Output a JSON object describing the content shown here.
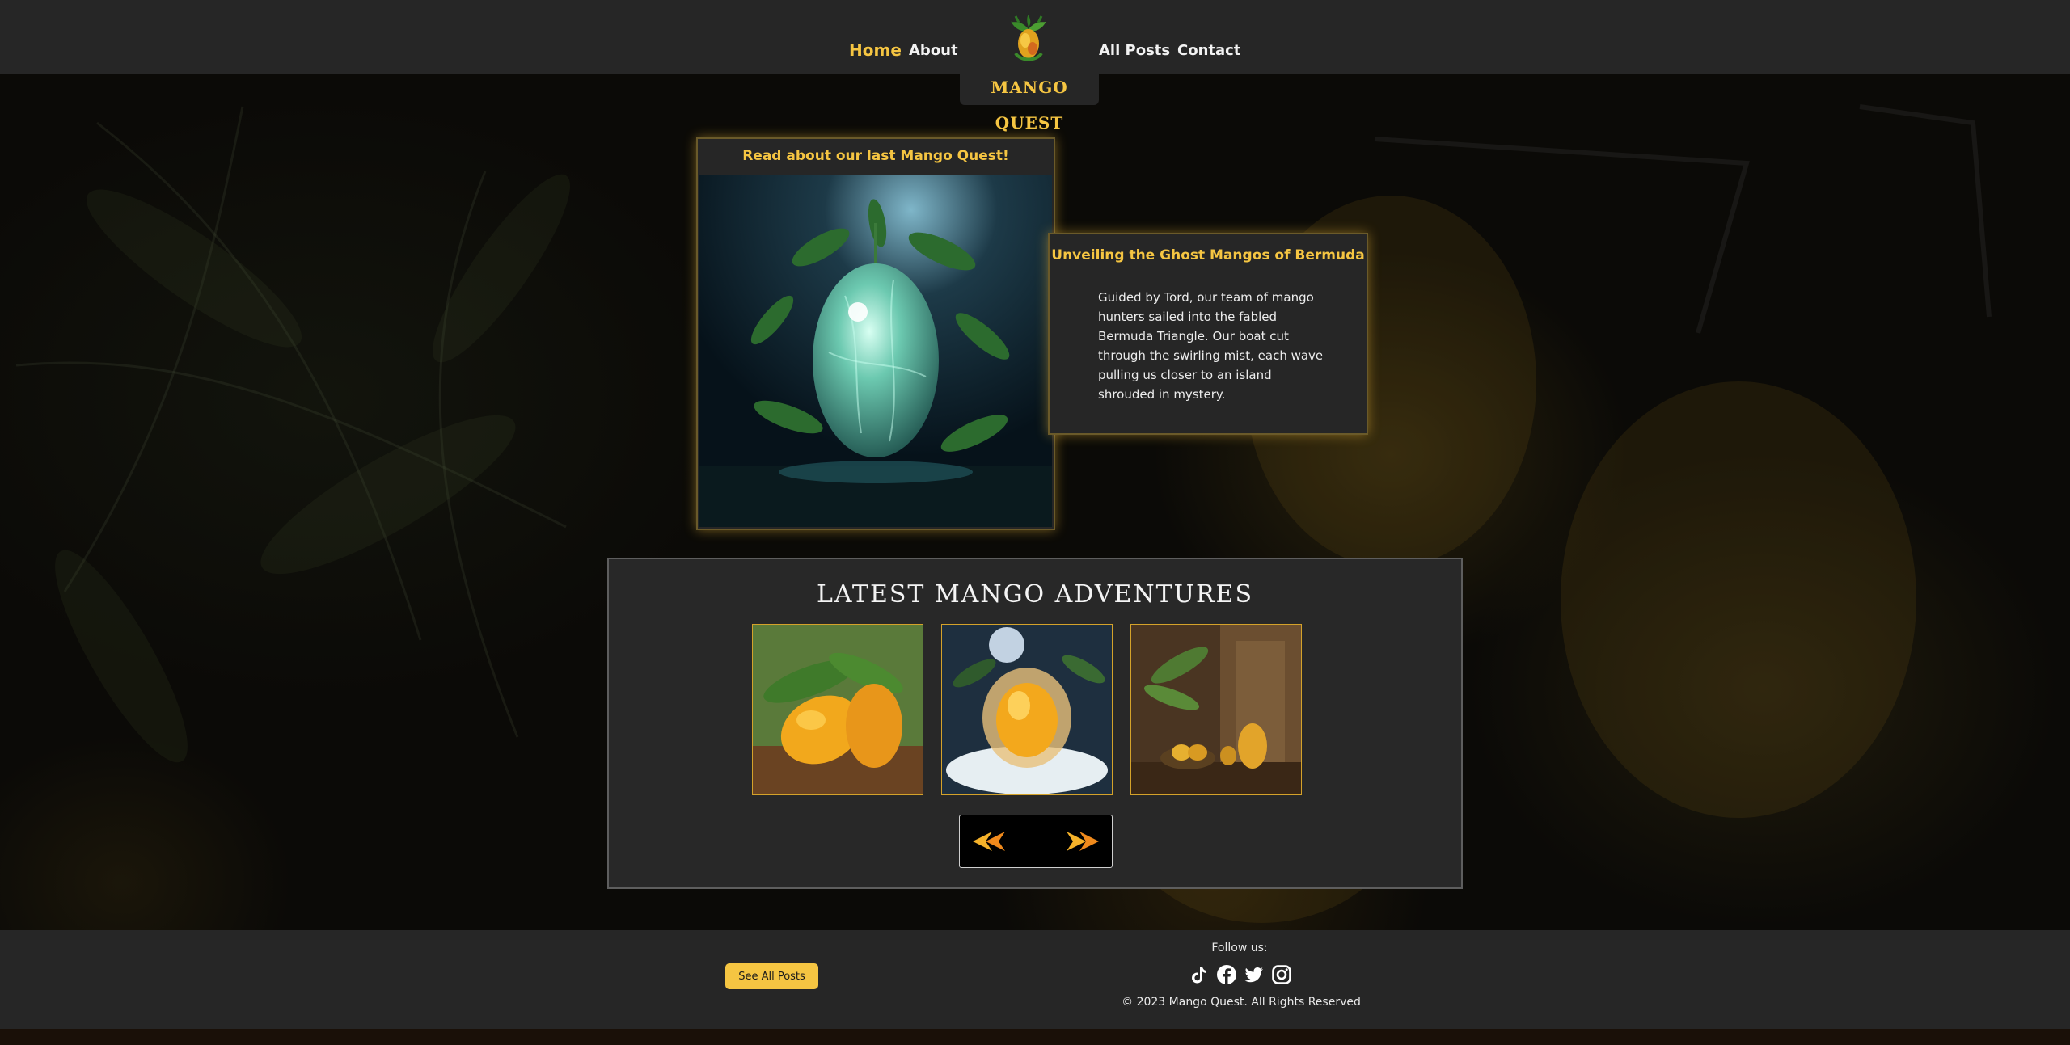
{
  "nav": {
    "home": "Home",
    "about": "About",
    "all_posts": "All Posts",
    "contact": "Contact",
    "brand": "MANGO QUEST"
  },
  "feature": {
    "heading": "Read about our last Mango Quest!",
    "image_icon": "ghost-mango-image"
  },
  "excerpt": {
    "title": "Unveiling the Ghost Mangos of Bermuda",
    "body": "Guided by Tord, our team of mango hunters sailed into the fabled Bermuda Triangle. Our boat cut through the swirling mist, each wave pulling us closer to an island shrouded in mystery."
  },
  "latest": {
    "heading": "LATEST MANGO ADVENTURES",
    "thumbs": [
      "mango-pair-image",
      "frozen-mango-image",
      "temple-mangos-image"
    ],
    "prev_icon": "arrow-left-icon",
    "next_icon": "arrow-right-icon"
  },
  "footer": {
    "see_all": "See All Posts",
    "follow": "Follow us:",
    "socials": [
      "tiktok-icon",
      "facebook-icon",
      "twitter-icon",
      "instagram-icon"
    ],
    "copyright": "© 2023 Mango Quest. All Rights Reserved"
  },
  "colors": {
    "accent": "#f5c542",
    "panel": "#262626",
    "background": "#0c0b08"
  }
}
